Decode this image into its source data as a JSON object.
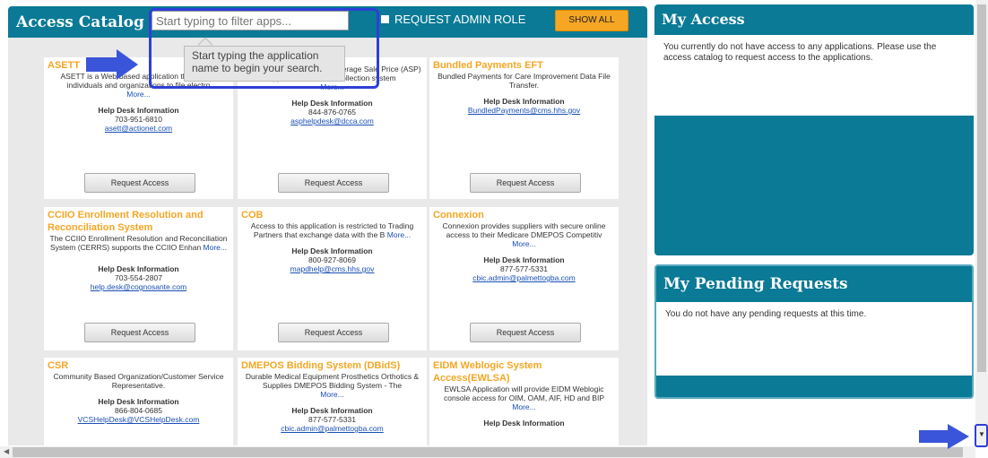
{
  "catalog": {
    "title": "Access Catalog",
    "filter_placeholder": "Start typing to filter apps...",
    "admin_label": "REQUEST ADMIN ROLE",
    "show_all": "SHOW ALL",
    "tooltip": "Start typing the application name to begin your search."
  },
  "cards": [
    {
      "title": "ASETT",
      "desc": "ASETT is a Web-based application that allows individuals and organizations to file electro",
      "more": "More...",
      "help_title": "Help Desk Information",
      "phone": "703-951-6810",
      "email": "asett@actionet.com",
      "button": "Request Access"
    },
    {
      "title": "",
      "desc": "The Medicare Part B Drug Average Sale Price (ASP) application is a data collection system",
      "more": "More...",
      "help_title": "Help Desk Information",
      "phone": "844-876-0765",
      "email": "asphelpdesk@dcca.com",
      "button": "Request Access"
    },
    {
      "title": "Bundled Payments EFT",
      "desc": "Bundled Payments for Care Improvement Data File Transfer.",
      "more": "",
      "help_title": "Help Desk Information",
      "phone": "",
      "email": "BundledPayments@cms.hhs.gov",
      "button": "Request Access"
    },
    {
      "title": "CCIIO Enrollment Resolution and Reconciliation System",
      "desc": "The CCIIO Enrollment Resolution and Reconciliation System (CERRS) supports the CCIIO Enhan",
      "more": "More...",
      "help_title": "Help Desk Information",
      "phone": "703-554-2807",
      "email": "help.desk@cognosante.com",
      "button": "Request Access"
    },
    {
      "title": "COB",
      "desc": "Access to this application is restricted to Trading Partners that exchange data with the B",
      "more": "More...",
      "help_title": "Help Desk Information",
      "phone": "800-927-8069",
      "email": "mapdhelp@cms.hhs.gov",
      "button": "Request Access"
    },
    {
      "title": "Connexion",
      "desc": "Connexion provides suppliers with secure online access to their Medicare DMEPOS Competitiv",
      "more": "More...",
      "help_title": "Help Desk Information",
      "phone": "877-577-5331",
      "email": "cbic.admin@palmettogba.com",
      "button": "Request Access"
    },
    {
      "title": "CSR",
      "desc": "Community Based Organization/Customer Service Representative.",
      "more": "",
      "help_title": "Help Desk Information",
      "phone": "866-804-0685",
      "email": "VCSHelpDesk@VCSHelpDesk.com",
      "button": ""
    },
    {
      "title": "DMEPOS Bidding System (DBidS)",
      "desc": "Durable Medical Equipment Prosthetics Orthotics & Supplies DMEPOS Bidding System - The",
      "more": "More...",
      "help_title": "Help Desk Information",
      "phone": "877-577-5331",
      "email": "cbic.admin@palmettogba.com",
      "button": ""
    },
    {
      "title": "EIDM Weblogic System Access(EWLSA)",
      "desc": "EWLSA Application will provide EIDM Weblogic console access for OIM, OAM, AIF, HD and BIP",
      "more": "More...",
      "help_title": "Help Desk Information",
      "phone": "",
      "email": "",
      "button": ""
    }
  ],
  "my_access": {
    "title": "My Access",
    "body": "You currently do not have access to any applications. Please use the access catalog to request access to the applications."
  },
  "pending": {
    "title": "My Pending Requests",
    "body": "You do not have any pending requests at this time."
  },
  "colors": {
    "accent": "#0a7a96",
    "card_title": "#f5a623",
    "highlight": "#2e3fd6"
  }
}
